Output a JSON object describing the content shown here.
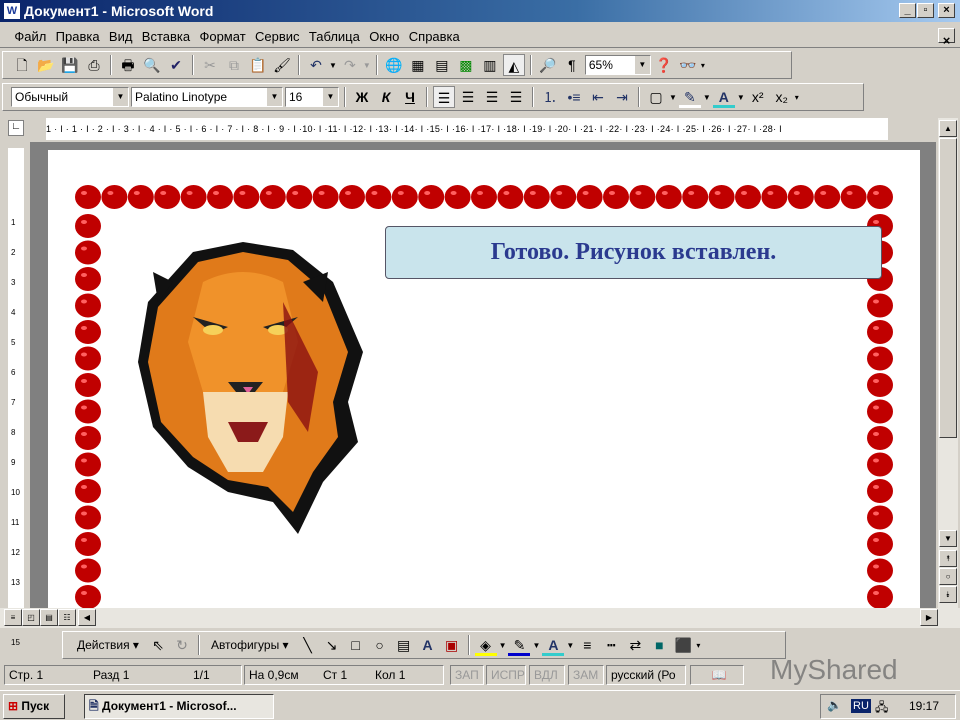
{
  "window": {
    "title": "Документ1 - Microsoft Word",
    "minimize": "_",
    "maximize": "▫",
    "close": "×"
  },
  "menu": [
    "Файл",
    "Правка",
    "Вид",
    "Вставка",
    "Формат",
    "Сервис",
    "Таблица",
    "Окно",
    "Справка"
  ],
  "standard_toolbar": {
    "zoom": "65%"
  },
  "formatting_toolbar": {
    "style": "Обычный",
    "font": "Palatino Linotype",
    "size": "16",
    "bold": "Ж",
    "italic": "К",
    "underline": "Ч"
  },
  "ruler": "1 · I · 1 · I · 2 · I · 3 · I · 4 · I · 5 · I · 6 · I · 7 · I · 8 · I · 9 · I ·10· I ·11· I ·12· I ·13· I ·14· I ·15· I ·16· I ·17· I ·18· I ·19· I ·20· I ·21· I ·22· I ·23· I ·24· I ·25· I ·26· I ·27· I ·28· I",
  "document": {
    "callout_text": "Готово. Рисунок вставлен.",
    "border_color": "#c00000",
    "callout_bg": "#c9e4ec",
    "callout_text_color": "#2b3a8f"
  },
  "drawing_toolbar": {
    "actions": "Действия ▾",
    "autoshapes": "Автофигуры ▾"
  },
  "status": {
    "page": "Стр. 1",
    "section": "Разд 1",
    "pages": "1/1",
    "at": "На 0,9см",
    "line": "Ст 1",
    "col": "Кол 1",
    "rec": "ЗАП",
    "trk": "ИСПР",
    "ext": "ВДЛ",
    "ovr": "ЗАМ",
    "language": "русский (Ро"
  },
  "taskbar": {
    "start": "Пуск",
    "task": "Документ1 - Microsof...",
    "lang": "RU",
    "clock": "19:17"
  },
  "watermark": "MyShared"
}
